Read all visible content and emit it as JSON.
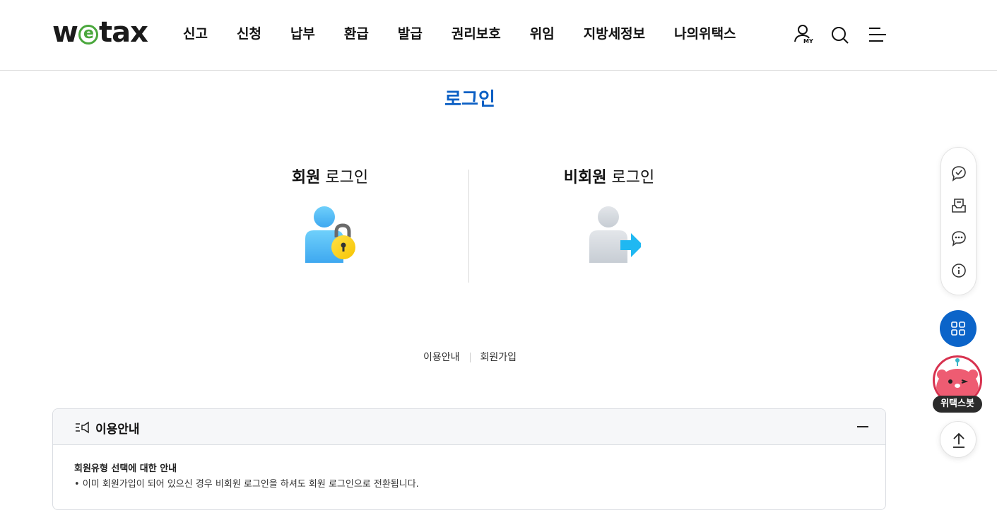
{
  "header": {
    "logo": {
      "prefix": "w",
      "circle_letter": "e",
      "suffix": "tax"
    },
    "nav": [
      "신고",
      "신청",
      "납부",
      "환급",
      "발급",
      "권리보호",
      "위임",
      "지방세정보",
      "나의위택스"
    ],
    "my_tag": "MY",
    "icons": [
      "user-icon",
      "search-icon",
      "menu-icon"
    ]
  },
  "page": {
    "title": "로그인"
  },
  "login": {
    "member": {
      "bold": "회원",
      "rest": " 로그인",
      "icon": "user-lock-icon"
    },
    "guest": {
      "bold": "비회원",
      "rest": " 로그인",
      "icon": "user-arrow-icon"
    }
  },
  "links": {
    "usage_guide": "이용안내",
    "signup": "회원가입"
  },
  "guide": {
    "title": "이용안내",
    "question": "회원유형 선택에 대한 안내",
    "answer": "• 이미 회원가입이 되어 있으신 경우 비회원 로그인을 하셔도 회원 로그인으로 전환됩니다."
  },
  "side": {
    "icons": [
      "chat-check-icon",
      "inbox-icon",
      "chat-dots-icon",
      "info-icon"
    ],
    "apps_icon": "grid-icon",
    "bot_label": "위택스봇",
    "top_icon": "arrow-up-icon"
  },
  "colors": {
    "brand_blue": "#0b5fc4",
    "logo_green": "#4aa73c",
    "bot_red": "#d7324f"
  }
}
